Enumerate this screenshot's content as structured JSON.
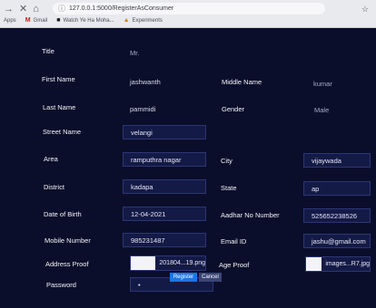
{
  "browser": {
    "url": "127.0.0.1:5000/RegisterAsConsumer",
    "bookmarks": [
      {
        "icon": "apps-icon",
        "label": "Apps"
      },
      {
        "icon": "gmail-icon",
        "label": "Gmail"
      },
      {
        "icon": "youtube-icon",
        "label": "Watch Ye Ha Moha..."
      },
      {
        "icon": "experiments-icon",
        "label": "Experiments"
      }
    ]
  },
  "form": {
    "title": {
      "label": "Title",
      "value": "Mr."
    },
    "first_name": {
      "label": "First Name",
      "value": "jashwanth"
    },
    "middle_name": {
      "label": "Middle Name",
      "value": "kumar"
    },
    "last_name": {
      "label": "Last Name",
      "value": "pammidi"
    },
    "gender": {
      "label": "Gender",
      "value": "Male"
    },
    "street_name": {
      "label": "Street Name",
      "value": "velangi"
    },
    "area": {
      "label": "Area",
      "value": "ramputhra nagar"
    },
    "city": {
      "label": "City",
      "value": "vijaywada"
    },
    "district": {
      "label": "District",
      "value": "kadapa"
    },
    "state": {
      "label": "State",
      "value": "ap"
    },
    "dob": {
      "label": "Date of Birth",
      "value": "12-04-2021"
    },
    "aadhar": {
      "label": "Aadhar No Number",
      "value": "525652238526"
    },
    "mobile": {
      "label": "Mobile Number",
      "value": "985231487"
    },
    "email": {
      "label": "Email ID",
      "value": "jashu@gmail.com"
    },
    "address_proof": {
      "label": "Address Proof",
      "file": "201804...19.png"
    },
    "age_proof": {
      "label": "Age Proof",
      "file": "images...R7.jpg"
    },
    "password": {
      "label": "Password",
      "value": "•"
    },
    "register_label": "Register",
    "cancel_label": "Cancel"
  }
}
